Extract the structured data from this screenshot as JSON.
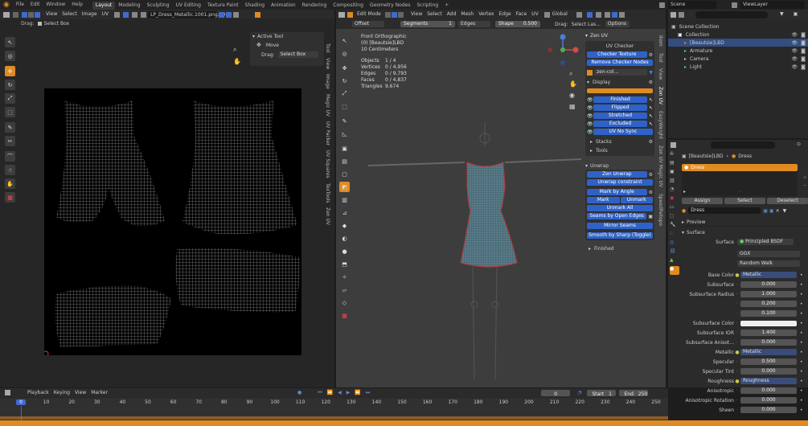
{
  "menu": {
    "items": [
      "File",
      "Edit",
      "Window",
      "Help"
    ]
  },
  "workspaces": [
    "Layout",
    "Modeling",
    "Sculpting",
    "UV Editing",
    "Texture Paint",
    "Shading",
    "Animation",
    "Rendering",
    "Compositing",
    "Geometry Nodes",
    "Scripting"
  ],
  "scene_name": "Scene",
  "view_layer": "ViewLayer",
  "uv_editor": {
    "menus": [
      "View",
      "Select",
      "Image",
      "UV"
    ],
    "image_name": "LP_Dress_Metallic.1001.png.001",
    "drag_label": "Drag:",
    "drag_value": "Select Box",
    "active_tool_title": "Active Tool",
    "tool_name": "Move",
    "npanel_tabs": [
      "Tool",
      "View",
      "Image",
      "Magic UV",
      "UV Packer",
      "UV Squares",
      "TexTools",
      "Zen UV"
    ]
  },
  "viewport": {
    "mode": "Edit Mode",
    "menus": [
      "View",
      "Select",
      "Add",
      "Mesh",
      "Vertex",
      "Edge",
      "Face",
      "UV"
    ],
    "transform": "Global",
    "options": "Options",
    "op_offset": "Offset",
    "op_segments": "Segments",
    "op_segments_val": "1",
    "op_edges": "Edges",
    "op_shape": "Shape",
    "op_shape_val": "0.500",
    "drag_label": "Drag:",
    "drag_value": "Select Las...",
    "view_name": "Front Orthographic",
    "object_name": "(0) [Beautsie]LBD",
    "scale": "10 Centimeters",
    "stats": [
      {
        "k": "Objects",
        "v": "1 / 4"
      },
      {
        "k": "Vertices",
        "v": "0 / 4,956"
      },
      {
        "k": "Edges",
        "v": "0 / 9,793"
      },
      {
        "k": "Faces",
        "v": "0 / 4,837"
      },
      {
        "k": "Triangles",
        "v": "9,674"
      }
    ],
    "npanel_tabs": [
      "Item",
      "Tool",
      "View",
      "Zen UV",
      "EasyWeight",
      "Zen UV Magic UV",
      "SpeedRetopo"
    ]
  },
  "zenuv": {
    "title": "Zen UV",
    "uv_checker": "UV Checker",
    "checker_texture": "Checker Texture",
    "remove_checker": "Remove Checker Nodes",
    "checker_image": "zen-col...",
    "display": "Display",
    "toggles": [
      "Finished",
      "Flipped",
      "Stretched",
      "Excluded",
      "UV No Sync"
    ],
    "stacks": "Stacks",
    "tools": "Tools",
    "unwrap": "Unwrap",
    "zen_unwrap": "Zen Unwrap",
    "unwrap_constraint": "Unwrap constraint",
    "mark_by_angle": "Mark by Angle",
    "mark": "Mark",
    "unmark": "Unmark",
    "unmark_all": "Unmark All",
    "seams_open": "Seams by Open Edges",
    "mirror_seams": "Mirror Seams",
    "smooth_sharp": "Smooth by Sharp (Toggle)",
    "finished": "Finished"
  },
  "outliner": {
    "items": [
      {
        "name": "Scene Collection",
        "indent": 0
      },
      {
        "name": "Collection",
        "indent": 1
      },
      {
        "name": "[Beautsie]LBD",
        "indent": 2,
        "selected": true
      },
      {
        "name": "Armature",
        "indent": 2
      },
      {
        "name": "Camera",
        "indent": 2
      },
      {
        "name": "Light",
        "indent": 2
      }
    ]
  },
  "properties": {
    "breadcrumb_object": "[Beautsie]LBD",
    "breadcrumb_material": "Dress",
    "material_slot": "Dress",
    "assign": "Assign",
    "select": "Select",
    "deselect": "Deselect",
    "material_name": "Dress",
    "preview": "Preview",
    "surface_header": "Surface",
    "surface_label": "Surface",
    "surface_value": "Principled BSDF",
    "distribution": "GGX",
    "sss_method": "Random Walk",
    "fields": [
      {
        "label": "Base Color",
        "value": "Metallic",
        "kind": "link"
      },
      {
        "label": "Subsurface",
        "value": "0.000",
        "kind": "num"
      },
      {
        "label": "Subsurface Radius",
        "value": "1.000",
        "kind": "num"
      },
      {
        "label": "",
        "value": "0.200",
        "kind": "num"
      },
      {
        "label": "",
        "value": "0.100",
        "kind": "num"
      },
      {
        "label": "Subsurface Color",
        "value": "",
        "kind": "color"
      },
      {
        "label": "Subsurface IOR",
        "value": "1.400",
        "kind": "num"
      },
      {
        "label": "Subsurface Anisot...",
        "value": "0.000",
        "kind": "num"
      },
      {
        "label": "Metallic",
        "value": "Metallic",
        "kind": "link"
      },
      {
        "label": "Specular",
        "value": "0.500",
        "kind": "num"
      },
      {
        "label": "Specular Tint",
        "value": "0.000",
        "kind": "num"
      },
      {
        "label": "Roughness",
        "value": "Roughness",
        "kind": "link"
      },
      {
        "label": "Anisotropic",
        "value": "0.000",
        "kind": "num"
      },
      {
        "label": "Anisotropic Rotation",
        "value": "0.000",
        "kind": "num"
      },
      {
        "label": "Sheen",
        "value": "0.000",
        "kind": "num"
      }
    ]
  },
  "timeline": {
    "menus": [
      "Playback",
      "Keying",
      "View",
      "Marker"
    ],
    "current_frame": "0",
    "start_label": "Start",
    "start": "1",
    "end_label": "End",
    "end": "250",
    "ticks": [
      "0",
      "10",
      "20",
      "30",
      "40",
      "50",
      "60",
      "70",
      "80",
      "90",
      "100",
      "110",
      "120",
      "130",
      "140",
      "150",
      "160",
      "170",
      "180",
      "190",
      "200",
      "210",
      "220",
      "230",
      "240",
      "250"
    ]
  },
  "colors": {
    "accent": "#e08b22",
    "blue": "#2e62c8",
    "select": "#3f5f9f"
  }
}
